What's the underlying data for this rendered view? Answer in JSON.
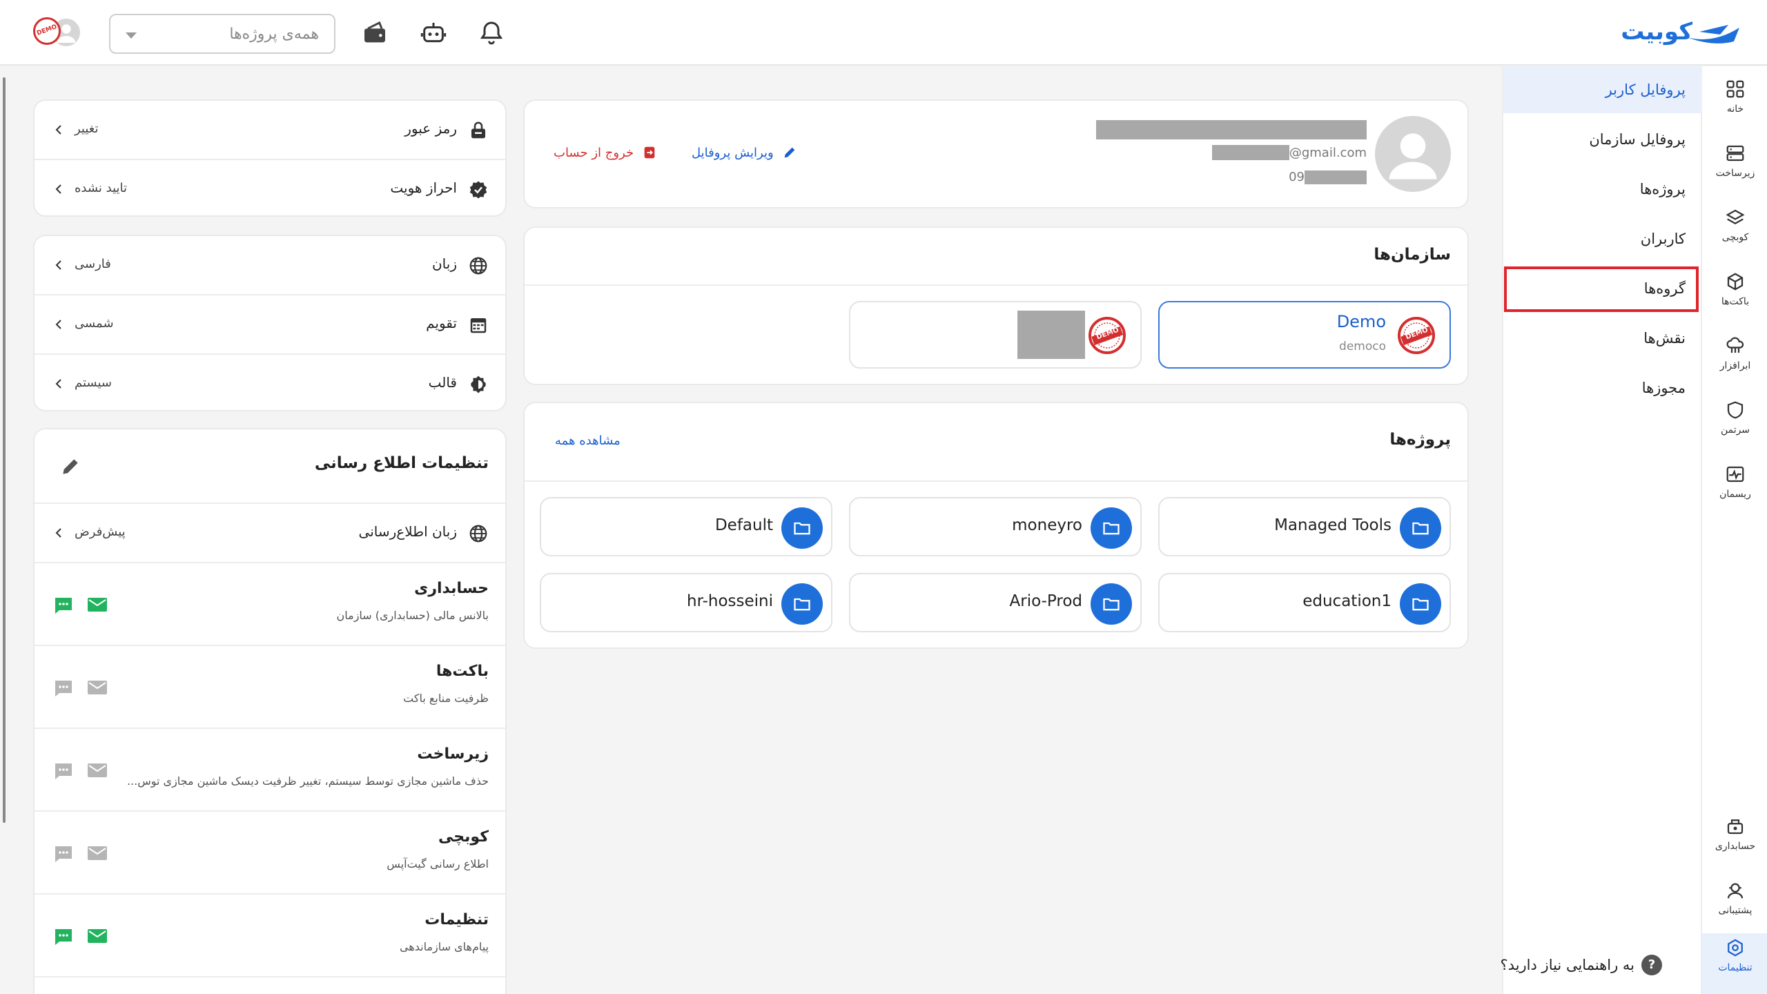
{
  "brand": {
    "name": "کوبیت",
    "color": "#1e6fd9"
  },
  "topbar": {
    "project_select_placeholder": "همه‌ی پروژه‌ها",
    "icons": [
      "bell-icon",
      "robot-icon",
      "wallet-icon"
    ],
    "avatar_badge": "DEMO"
  },
  "rail": {
    "items": [
      {
        "label": "خانه",
        "icon": "grid-icon"
      },
      {
        "label": "زیرساخت",
        "icon": "server-icon"
      },
      {
        "label": "کوبچی",
        "icon": "layers-icon"
      },
      {
        "label": "باکت‌ها",
        "icon": "cube-icon"
      },
      {
        "label": "ابرافزار",
        "icon": "cloud-app-icon"
      },
      {
        "label": "سرتمن",
        "icon": "shield-icon"
      },
      {
        "label": "ریسمان",
        "icon": "pulse-icon"
      },
      {
        "label": "حسابداری",
        "icon": "accounting-icon"
      },
      {
        "label": "پشتیبانی",
        "icon": "support-icon"
      },
      {
        "label": "تنظیمات",
        "icon": "settings-icon"
      }
    ],
    "active": "تنظیمات"
  },
  "subnav": {
    "items": [
      "پروفایل کاربر",
      "پروفایل سازمان",
      "پروژه‌ها",
      "کاربران",
      "گروه‌ها",
      "نقش‌ها",
      "مجوزها"
    ],
    "active": "پروفایل کاربر",
    "highlighted": "گروه‌ها",
    "help": "به راهنمایی نیاز دارید؟"
  },
  "profile": {
    "email_suffix": "@gmail.com",
    "phone_prefix": "09",
    "edit_label": "ویرایش پروفایل",
    "logout_label": "خروج از حساب"
  },
  "orgs": {
    "title": "سازمان‌ها",
    "items": [
      {
        "name": "Demo",
        "sub": "democo",
        "badge": "DEMO",
        "selected": true
      },
      {
        "name": "",
        "sub": "",
        "badge": "DEMO",
        "selected": false
      }
    ]
  },
  "projects": {
    "title": "پروژه‌ها",
    "see_all": "مشاهده همه",
    "items": [
      "Managed Tools",
      "moneyro",
      "Default",
      "education1",
      "Ario-Prod",
      "hr-hosseini"
    ]
  },
  "security": {
    "password_label": "رمز عبور",
    "password_value": "تغییر",
    "identity_label": "احراز هویت",
    "identity_value": "تایید نشده"
  },
  "prefs": {
    "language_label": "زبان",
    "language_value": "فارسی",
    "calendar_label": "تقویم",
    "calendar_value": "شمسی",
    "theme_label": "قالب",
    "theme_value": "سیستم"
  },
  "notifications": {
    "title": "تنظیمات اطلاع رسانی",
    "lang_label": "زبان اطلاع‌رسانی",
    "lang_value": "پیش‌فرض",
    "items": [
      {
        "title": "حسابداری",
        "desc": "بالانس مالی (حسابداری) سازمان",
        "sms": true,
        "email": true
      },
      {
        "title": "باکت‌ها",
        "desc": "ظرفیت منابع باکت",
        "sms": false,
        "email": false
      },
      {
        "title": "زیرساخت",
        "desc": "حذف ماشین مجازی توسط سیستم، تغییر ظرفیت دیسک ماشین مجازی توس...",
        "sms": false,
        "email": false
      },
      {
        "title": "کوبچی",
        "desc": "اطلاع رسانی گیت‌آپس",
        "sms": false,
        "email": false
      },
      {
        "title": "تنظیمات",
        "desc": "پیام‌های سازماندهی",
        "sms": true,
        "email": true
      }
    ],
    "active_color": "#22b35e",
    "inactive_color": "#b5b5b5"
  }
}
